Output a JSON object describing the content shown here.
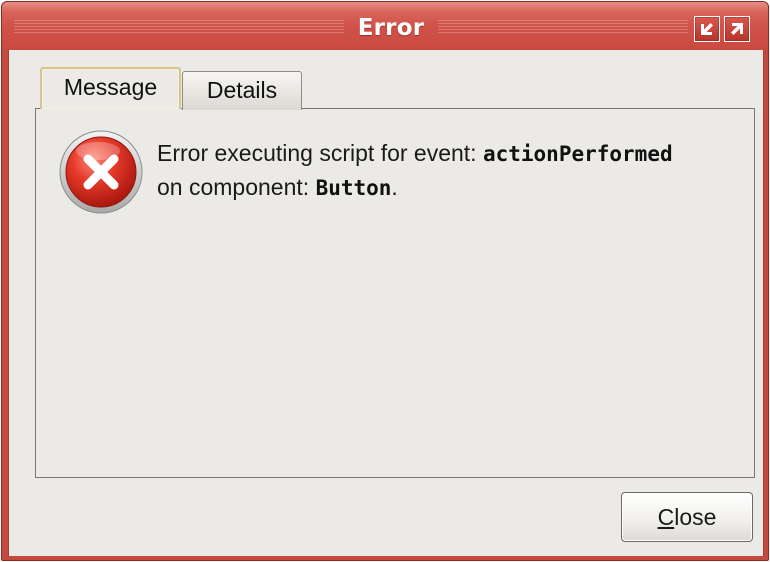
{
  "window": {
    "title": "Error",
    "accent_color": "#cf5147",
    "controls": [
      {
        "name": "minimize",
        "icon": "arrow-down-left-icon"
      },
      {
        "name": "maximize",
        "icon": "arrow-up-right-icon"
      }
    ]
  },
  "tabs": [
    {
      "label": "Message",
      "selected": true
    },
    {
      "label": "Details",
      "selected": false
    }
  ],
  "message": {
    "icon": "error-x-icon",
    "line1_prefix": "Error executing script for event: ",
    "event_name": "actionPerformed",
    "line2_prefix": "on component: ",
    "component_name": "Button",
    "line2_suffix": "."
  },
  "buttons": {
    "close_mnemonic": "C",
    "close_rest": "lose"
  }
}
